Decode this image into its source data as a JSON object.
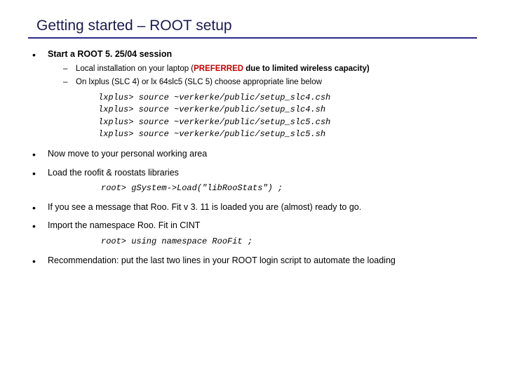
{
  "title": "Getting started – ROOT setup",
  "b1": {
    "text": "Start a ROOT 5. 25/04 session",
    "s1a": "Local installation on your laptop (",
    "s1pref": "PREFERRED",
    "s1b": " due to limited wireless capacity)",
    "s2": "On lxplus (SLC 4) or lx 64slc5 (SLC 5) choose appropriate line below",
    "code": "lxplus> source ~verkerke/public/setup_slc4.csh\nlxplus> source ~verkerke/public/setup_slc4.sh\nlxplus> source ~verkerke/public/setup_slc5.csh\nlxplus> source ~verkerke/public/setup_slc5.sh"
  },
  "b2": "Now move to your personal working area",
  "b3": {
    "text": "Load the roofit & roostats libraries",
    "code": "root> gSystem->Load(\"libRooStats\") ;"
  },
  "b4": "If you see a message that Roo. Fit v 3. 11 is loaded you are (almost) ready to go.",
  "b5": {
    "text": "Import the namespace Roo. Fit in CINT",
    "code": "root> using namespace RooFit ;"
  },
  "b6": "Recommendation: put the last two lines in your ROOT login script to automate the loading"
}
